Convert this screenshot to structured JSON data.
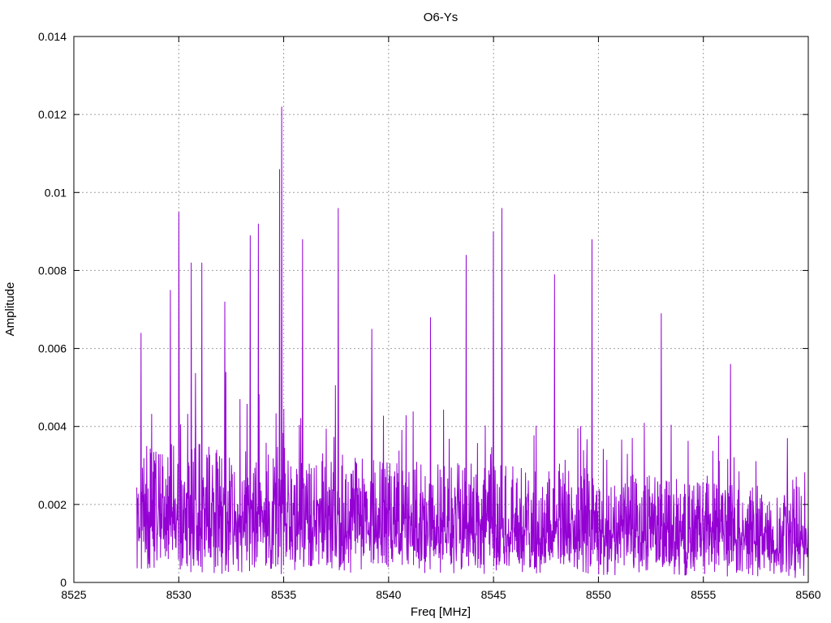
{
  "chart_data": {
    "type": "line",
    "title": "O6-Ys",
    "xlabel": "Freq [MHz]",
    "ylabel": "Amplitude",
    "xlim": [
      8525,
      8560
    ],
    "ylim": [
      0,
      0.014
    ],
    "grid": true,
    "x_ticks": [
      "8525",
      "8530",
      "8535",
      "8540",
      "8545",
      "8550",
      "8555",
      "8560"
    ],
    "y_ticks": [
      "0",
      "0.002",
      "0.004",
      "0.006",
      "0.008",
      "0.01",
      "0.012",
      "0.014"
    ],
    "series": [
      {
        "color": "#9400d3",
        "x_start": 8528,
        "x_end": 8560,
        "noise_floor_amplitude": 0.0035,
        "peaks": [
          {
            "x": 8528.2,
            "y": 0.0064
          },
          {
            "x": 8529.6,
            "y": 0.0075
          },
          {
            "x": 8530.0,
            "y": 0.0095
          },
          {
            "x": 8530.6,
            "y": 0.0082
          },
          {
            "x": 8531.1,
            "y": 0.0082
          },
          {
            "x": 8532.2,
            "y": 0.0072
          },
          {
            "x": 8533.4,
            "y": 0.0089
          },
          {
            "x": 8533.8,
            "y": 0.0092
          },
          {
            "x": 8534.8,
            "y": 0.0106
          },
          {
            "x": 8534.9,
            "y": 0.0122
          },
          {
            "x": 8535.9,
            "y": 0.0088
          },
          {
            "x": 8537.6,
            "y": 0.0096
          },
          {
            "x": 8539.2,
            "y": 0.0065
          },
          {
            "x": 8542.0,
            "y": 0.0068
          },
          {
            "x": 8543.7,
            "y": 0.0084
          },
          {
            "x": 8545.0,
            "y": 0.009
          },
          {
            "x": 8545.4,
            "y": 0.0096
          },
          {
            "x": 8547.9,
            "y": 0.0079
          },
          {
            "x": 8549.7,
            "y": 0.0088
          },
          {
            "x": 8553.0,
            "y": 0.0069
          },
          {
            "x": 8556.3,
            "y": 0.0056
          },
          {
            "x": 8559.0,
            "y": 0.0037
          }
        ]
      }
    ]
  }
}
